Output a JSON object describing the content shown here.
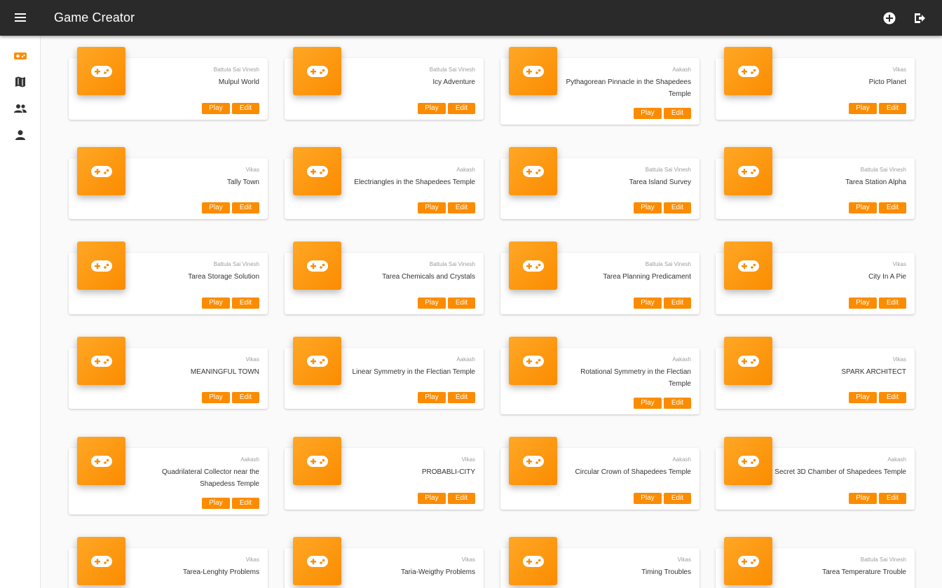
{
  "app": {
    "title": "Game Creator",
    "accent": "#fb8c00",
    "topbar_color": "#2a2a2a"
  },
  "topbar": {
    "menu_icon": "hamburger-menu-icon",
    "actions": [
      "add-circle-icon",
      "logout-icon"
    ]
  },
  "sidebar": {
    "items": [
      {
        "icon": "gamepad-icon",
        "active": true
      },
      {
        "icon": "map-icon",
        "active": false
      },
      {
        "icon": "people-icon",
        "active": false
      },
      {
        "icon": "person-icon",
        "active": false
      }
    ]
  },
  "labels": {
    "play": "Play",
    "edit": "Edit"
  },
  "games": [
    {
      "author": "Battula Sai Vinesh",
      "title": "Mulpul World"
    },
    {
      "author": "Battula Sai Vinesh",
      "title": "Icy Adventure"
    },
    {
      "author": "Aakash",
      "title": "Pythagorean Pinnacle in the Shapedees Temple"
    },
    {
      "author": "Vikas",
      "title": "Picto Planet"
    },
    {
      "author": "Vikas",
      "title": "Tally Town"
    },
    {
      "author": "Aakash",
      "title": "Electriangles in the Shapedees Temple"
    },
    {
      "author": "Battula Sai Vinesh",
      "title": "Tarea Island Survey"
    },
    {
      "author": "Battula Sai Vinesh",
      "title": "Tarea Station Alpha"
    },
    {
      "author": "Battula Sai Vinesh",
      "title": "Tarea Storage Solution"
    },
    {
      "author": "Battula Sai Vinesh",
      "title": "Tarea Chemicals and Crystals"
    },
    {
      "author": "Battula Sai Vinesh",
      "title": "Tarea Planning Predicament"
    },
    {
      "author": "Vikas",
      "title": "City In A Pie"
    },
    {
      "author": "Vikas",
      "title": "MEANINGFUL TOWN"
    },
    {
      "author": "Aakash",
      "title": "Linear Symmetry in the Flectian Temple"
    },
    {
      "author": "Aakash",
      "title": "Rotational Symmetry in the Flectian Temple"
    },
    {
      "author": "Vikas",
      "title": "SPARK ARCHITECT"
    },
    {
      "author": "Aakash",
      "title": "Quadrilateral Collector near the Shapedess Temple"
    },
    {
      "author": "Vikas",
      "title": "PROBABLI-CITY"
    },
    {
      "author": "Aakash",
      "title": "Circular Crown of Shapedees Temple"
    },
    {
      "author": "Aakash",
      "title": "Secret 3D Chamber of Shapedees Temple"
    },
    {
      "author": "Vikas",
      "title": "Tarea-Lenghty Problems"
    },
    {
      "author": "Vikas",
      "title": "Taria-Weigthy Problems"
    },
    {
      "author": "Vikas",
      "title": "Timing Troubles"
    },
    {
      "author": "Battula Sai Vinesh",
      "title": "Tarea Temperature Trouble"
    }
  ]
}
